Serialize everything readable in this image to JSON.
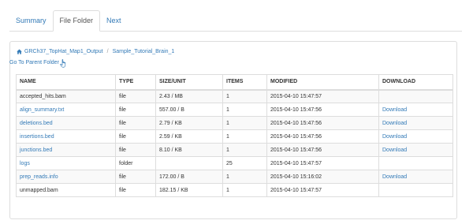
{
  "tabs": [
    {
      "label": "Summary",
      "active": false
    },
    {
      "label": "File Folder",
      "active": true
    },
    {
      "label": "Next",
      "active": false
    }
  ],
  "breadcrumb": {
    "icon": "home-icon",
    "items": [
      "GRCh37_TopHat_Map1_Output",
      "Sample_Tutorial_Brain_1"
    ],
    "separator": "/"
  },
  "parent_link": {
    "label": "Go To Parent Folder",
    "icon": "hand-pointer-icon"
  },
  "table": {
    "headers": [
      "NAME",
      "TYPE",
      "SIZE/UNIT",
      "ITEMS",
      "MODIFIED",
      "DOWNLOAD"
    ],
    "rows": [
      {
        "name": "accepted_hits.bam",
        "name_link": false,
        "type": "file",
        "size": "2.43 / MB",
        "items": "1",
        "modified": "2015-04-10 15:47:57",
        "download": ""
      },
      {
        "name": "align_summary.txt",
        "name_link": true,
        "type": "file",
        "size": "557.00 / B",
        "items": "1",
        "modified": "2015-04-10 15:47:56",
        "download": "Download"
      },
      {
        "name": "deletions.bed",
        "name_link": true,
        "type": "file",
        "size": "2.79 / KB",
        "items": "1",
        "modified": "2015-04-10 15:47:56",
        "download": "Download"
      },
      {
        "name": "insertions.bed",
        "name_link": true,
        "type": "file",
        "size": "2.59 / KB",
        "items": "1",
        "modified": "2015-04-10 15:47:56",
        "download": "Download"
      },
      {
        "name": "junctions.bed",
        "name_link": true,
        "type": "file",
        "size": "8.10 / KB",
        "items": "1",
        "modified": "2015-04-10 15:47:56",
        "download": "Download"
      },
      {
        "name": "logs",
        "name_link": true,
        "type": "folder",
        "size": "",
        "items": "25",
        "modified": "2015-04-10 15:47:57",
        "download": ""
      },
      {
        "name": "prep_reads.info",
        "name_link": true,
        "type": "file",
        "size": "172.00 / B",
        "items": "1",
        "modified": "2015-04-10 15:16:02",
        "download": "Download"
      },
      {
        "name": "unmapped.bam",
        "name_link": false,
        "type": "file",
        "size": "182.15 / KB",
        "items": "1",
        "modified": "2015-04-10 15:47:57",
        "download": ""
      }
    ]
  },
  "colors": {
    "link": "#337ab7",
    "text": "#333333",
    "border": "#dddddd",
    "stripe": "#f9f9f9"
  }
}
